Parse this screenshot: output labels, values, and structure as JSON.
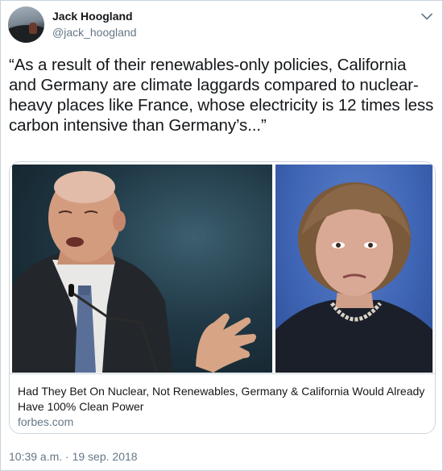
{
  "author": {
    "display_name": "Jack Hoogland",
    "handle": "@jack_hoogland"
  },
  "tweet": {
    "text": "“As a result of their renewables-only policies, California and Germany are climate laggards compared to nuclear-heavy places like France, whose electricity is 12 times less carbon intensive than Germany’s...”",
    "timestamp": "10:39 a.m. · 19 sep. 2018"
  },
  "card": {
    "title": "Had They Bet On Nuclear, Not Renewables, Germany & California Would Already Have 100% Clean Power",
    "domain": "forbes.com"
  },
  "icons": {
    "menu": "chevron-down-icon"
  },
  "colors": {
    "text": "#14171a",
    "secondary": "#657786",
    "border": "#ccd6dd"
  }
}
